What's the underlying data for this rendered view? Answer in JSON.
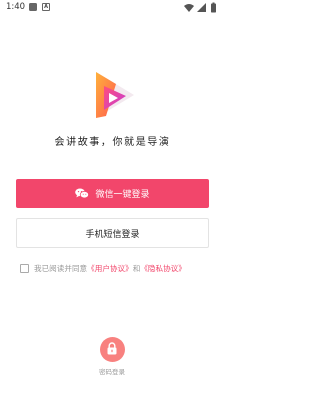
{
  "status_bar": {
    "time": "1:40",
    "icons": [
      "notification-icon",
      "a-box-icon",
      "wifi-icon",
      "cell-signal-icon",
      "battery-icon"
    ],
    "small_badge": "A"
  },
  "brand": {
    "logo": "play-triangle-logo",
    "slogan": "会讲故事，你就是导演"
  },
  "buttons": {
    "wechat_login": "微信一键登录",
    "sms_login": "手机短信登录"
  },
  "agreement": {
    "prefix": "我已阅读并同意",
    "user_agreement": "《用户协议》",
    "and": "和",
    "privacy_agreement": "《隐私协议》"
  },
  "password_login": {
    "label": "密码登录",
    "icon": "lock-icon"
  },
  "colors": {
    "primary": "#f2466b",
    "lock_bg": "#f8817f"
  }
}
